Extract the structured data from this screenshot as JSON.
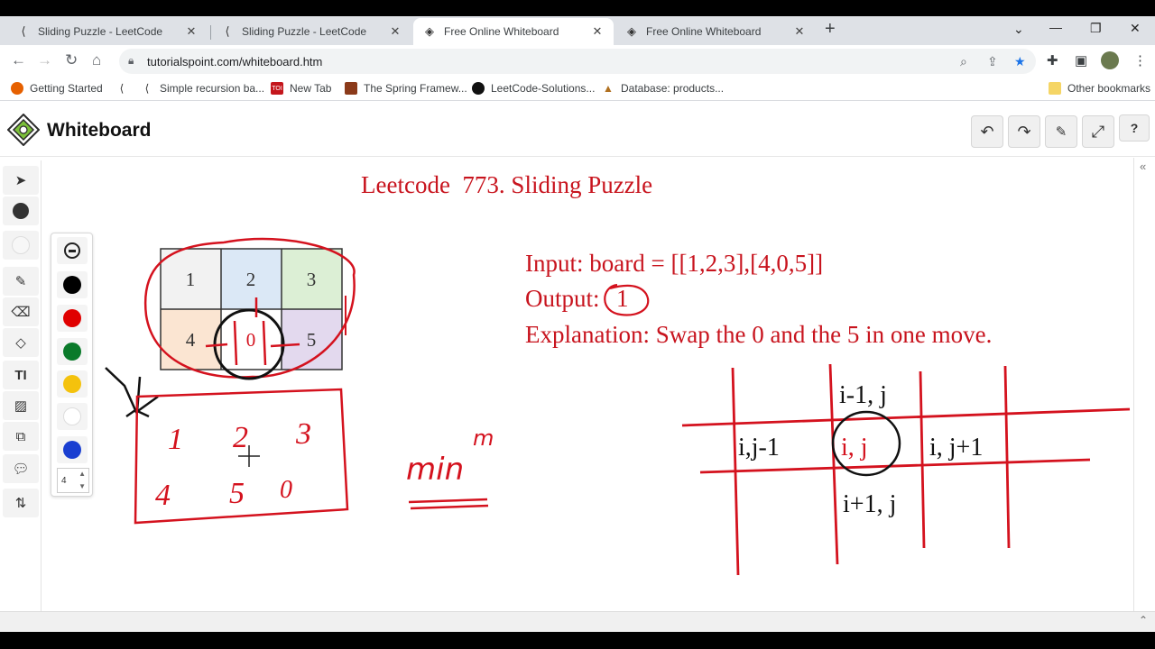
{
  "browser": {
    "tabs": [
      {
        "title": "Sliding Puzzle - LeetCode",
        "icon": "leetcode-icon",
        "active": false
      },
      {
        "title": "Sliding Puzzle - LeetCode",
        "icon": "leetcode-icon",
        "active": false
      },
      {
        "title": "Free Online Whiteboard",
        "icon": "tutorialspoint-icon",
        "active": true
      },
      {
        "title": "Free Online Whiteboard",
        "icon": "tutorialspoint-icon",
        "active": false
      }
    ],
    "url": "tutorialspoint.com/whiteboard.htm",
    "bookmarks": [
      {
        "label": "Getting Started",
        "icon": "firefox-icon"
      },
      {
        "label": "Simple recursion ba...",
        "icon": "leetcode-icon"
      },
      {
        "label": "New Tab",
        "icon": "toi-icon"
      },
      {
        "label": "The Spring Framew...",
        "icon": "bookmark-icon"
      },
      {
        "label": "LeetCode-Solutions...",
        "icon": "github-icon"
      },
      {
        "label": "Database: products...",
        "icon": "database-icon"
      }
    ],
    "other_bookmarks": "Other bookmarks"
  },
  "app": {
    "title": "Whiteboard",
    "pen_size": "4",
    "palette_colors": [
      "#000000",
      "#e00000",
      "#0a7a2a",
      "#f4c20d",
      "#ffffff",
      "#1a3fd1"
    ]
  },
  "board": {
    "title": "Leetcode  773. Sliding Puzzle",
    "input_line": "Input: board = [[1,2,3],[4,0,5]]",
    "output_label": "Output:",
    "output_value": "1",
    "explanation": "Explanation: Swap the 0 and the 5 in one move.",
    "grid_cells": [
      "1",
      "2",
      "3",
      "4",
      "0",
      "5"
    ],
    "grid_colors": [
      "#f2f2f2",
      "#dbe8f6",
      "#dcefd5",
      "#fbe5d2",
      "#ffffff",
      "#e3d9ee"
    ],
    "handwritten_digits": [
      "1",
      "2",
      "3",
      "4",
      "5",
      "0"
    ],
    "min_note": "min",
    "min_superscript": "m",
    "neighbor_top": "i-1, j",
    "neighbor_left": "i,j-1",
    "neighbor_center": "i, j",
    "neighbor_right": "i, j+1",
    "neighbor_bottom": "i+1, j"
  }
}
